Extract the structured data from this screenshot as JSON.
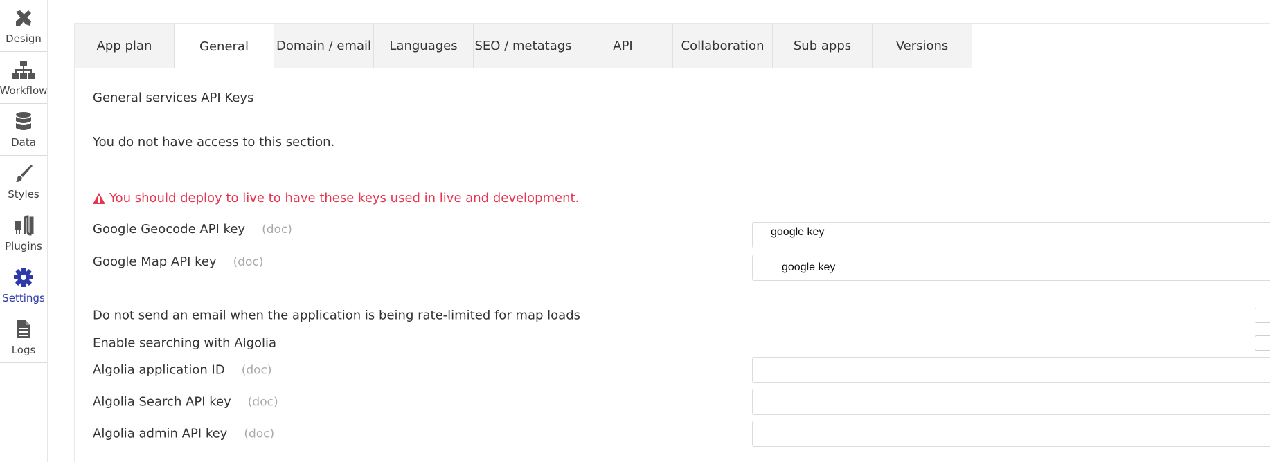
{
  "sidebar": {
    "items": [
      {
        "label": "Design",
        "icon": "design-icon"
      },
      {
        "label": "Workflow",
        "icon": "workflow-icon"
      },
      {
        "label": "Data",
        "icon": "database-icon"
      },
      {
        "label": "Styles",
        "icon": "brush-icon"
      },
      {
        "label": "Plugins",
        "icon": "plug-icon"
      },
      {
        "label": "Settings",
        "icon": "gear-icon",
        "active": true
      },
      {
        "label": "Logs",
        "icon": "document-icon"
      }
    ]
  },
  "tabs": [
    {
      "label": "App plan"
    },
    {
      "label": "General",
      "active": true
    },
    {
      "label": "Domain / email"
    },
    {
      "label": "Languages"
    },
    {
      "label": "SEO / metatags"
    },
    {
      "label": "API"
    },
    {
      "label": "Collaboration"
    },
    {
      "label": "Sub apps"
    },
    {
      "label": "Versions"
    }
  ],
  "section": {
    "title": "General services API Keys",
    "no_access": "You do not have access to this section.",
    "warning": "You should deploy to live to have these keys used in live and development."
  },
  "settings": {
    "geocode_label": "Google Geocode API key",
    "geocode_value": "google key",
    "map_label": "Google Map API key",
    "map_value": "google key",
    "rate_limit_label": "Do not send an email when the application is being rate-limited for map loads",
    "algolia_enable_label": "Enable searching with Algolia",
    "algolia_app_id_label": "Algolia application ID",
    "algolia_search_key_label": "Algolia Search API key",
    "algolia_admin_key_label": "Algolia admin API key",
    "doc_link": "(doc)"
  },
  "colors": {
    "accent": "#2d3ba8",
    "warning": "#e8344e"
  }
}
